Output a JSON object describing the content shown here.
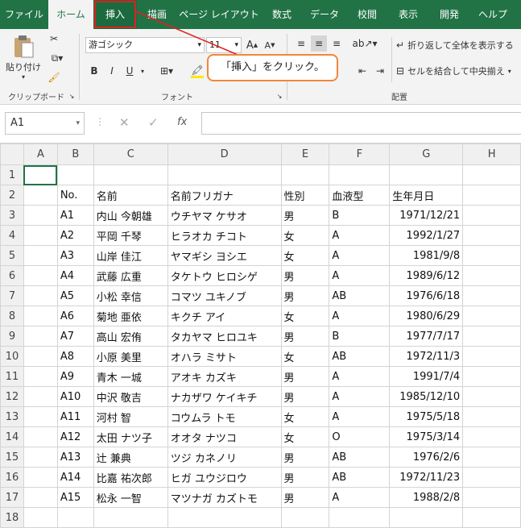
{
  "tabs": [
    {
      "label": "ファイル"
    },
    {
      "label": "ホーム"
    },
    {
      "label": "挿入"
    },
    {
      "label": "描画"
    },
    {
      "label": "ページ レイアウト"
    },
    {
      "label": "数式"
    },
    {
      "label": "データ"
    },
    {
      "label": "校閲"
    },
    {
      "label": "表示"
    },
    {
      "label": "開発"
    },
    {
      "label": "ヘルプ"
    }
  ],
  "ribbon": {
    "paste_label": "貼り付け",
    "clipboard_label": "クリップボード",
    "font_name": "游ゴシック",
    "font_size": "11",
    "font_group_label": "フォント",
    "wrap_label": "折り返して全体を表示する",
    "merge_label": "セルを結合して中央揃え",
    "align_group_label": "配置",
    "bold": "B",
    "italic": "I",
    "underline": "U",
    "grow": "A",
    "shrink": "A"
  },
  "callout_text": "「挿入」をクリック。",
  "formula_bar": {
    "name_box": "A1",
    "fx": "fx",
    "value": ""
  },
  "columns": [
    "A",
    "B",
    "C",
    "D",
    "E",
    "F",
    "G",
    "H"
  ],
  "rows": [
    [
      "",
      "",
      "",
      "",
      "",
      "",
      ""
    ],
    [
      "",
      "No.",
      "名前",
      "名前フリガナ",
      "性別",
      "血液型",
      "生年月日"
    ],
    [
      "",
      "A1",
      "内山 今朝雄",
      "ウチヤマ ケサオ",
      "男",
      "B",
      "1971/12/21"
    ],
    [
      "",
      "A2",
      "平岡 千琴",
      "ヒラオカ チコト",
      "女",
      "A",
      "1992/1/27"
    ],
    [
      "",
      "A3",
      "山岸 佳江",
      "ヤマギシ ヨシエ",
      "女",
      "A",
      "1981/9/8"
    ],
    [
      "",
      "A4",
      "武藤 広重",
      "タケトウ ヒロシゲ",
      "男",
      "A",
      "1989/6/12"
    ],
    [
      "",
      "A5",
      "小松 幸信",
      "コマツ ユキノブ",
      "男",
      "AB",
      "1976/6/18"
    ],
    [
      "",
      "A6",
      "菊地 亜依",
      "キクチ アイ",
      "女",
      "A",
      "1980/6/29"
    ],
    [
      "",
      "A7",
      "高山 宏侑",
      "タカヤマ ヒロユキ",
      "男",
      "B",
      "1977/7/17"
    ],
    [
      "",
      "A8",
      "小原 美里",
      "オハラ ミサト",
      "女",
      "AB",
      "1972/11/3"
    ],
    [
      "",
      "A9",
      "青木 一城",
      "アオキ カズキ",
      "男",
      "A",
      "1991/7/4"
    ],
    [
      "",
      "A10",
      "中沢 敬吉",
      "ナカザワ ケイキチ",
      "男",
      "A",
      "1985/12/10"
    ],
    [
      "",
      "A11",
      "河村 智",
      "コウムラ トモ",
      "女",
      "A",
      "1975/5/18"
    ],
    [
      "",
      "A12",
      "太田 ナツ子",
      "オオタ ナツコ",
      "女",
      "O",
      "1975/3/14"
    ],
    [
      "",
      "A13",
      "辻 兼典",
      "ツジ カネノリ",
      "男",
      "AB",
      "1976/2/6"
    ],
    [
      "",
      "A14",
      "比嘉 祐次郎",
      "ヒガ ユウジロウ",
      "男",
      "AB",
      "1972/11/23"
    ],
    [
      "",
      "A15",
      "松永 一智",
      "マツナガ カズトモ",
      "男",
      "A",
      "1988/2/8"
    ],
    [
      "",
      "",
      "",
      "",
      "",
      "",
      ""
    ]
  ],
  "colors": {
    "accent": "#217346",
    "highlight_box": "#e02020",
    "callout_border": "#f0883a"
  }
}
